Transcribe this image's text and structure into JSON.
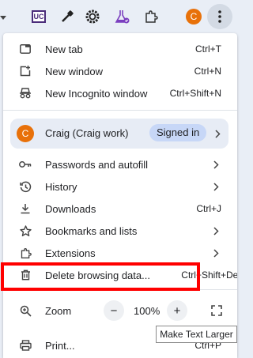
{
  "toolbar": {
    "extension_uc_label": "UC",
    "avatar_letter": "C"
  },
  "menu": {
    "new_tab": {
      "label": "New tab",
      "shortcut": "Ctrl+T"
    },
    "new_window": {
      "label": "New window",
      "shortcut": "Ctrl+N"
    },
    "new_incognito": {
      "label": "New Incognito window",
      "shortcut": "Ctrl+Shift+N"
    },
    "profile": {
      "avatar_letter": "C",
      "name": "Craig (Craig work)",
      "status": "Signed in"
    },
    "passwords": {
      "label": "Passwords and autofill"
    },
    "history": {
      "label": "History"
    },
    "downloads": {
      "label": "Downloads",
      "shortcut": "Ctrl+J"
    },
    "bookmarks": {
      "label": "Bookmarks and lists"
    },
    "extensions": {
      "label": "Extensions"
    },
    "delete_data": {
      "label": "Delete browsing data...",
      "shortcut": "Ctrl+Shift+Del"
    },
    "zoom": {
      "label": "Zoom",
      "minus": "−",
      "value": "100%",
      "plus": "+"
    },
    "print": {
      "label": "Print...",
      "shortcut": "Ctrl+P"
    }
  },
  "tooltip": {
    "text": "Make Text Larger"
  },
  "colors": {
    "accent_orange": "#e8710a",
    "highlight_red": "#ff0000",
    "signed_in_badge": "#c7d7f7"
  }
}
